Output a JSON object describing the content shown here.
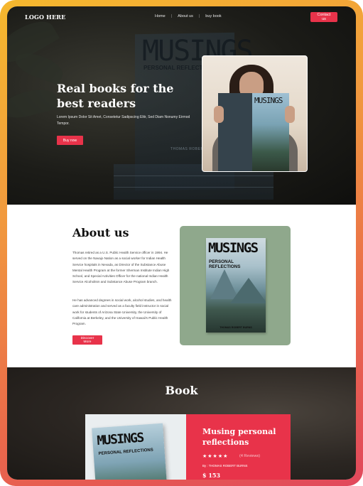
{
  "nav": {
    "logo": "LOGO HERE",
    "links": [
      "Home",
      "About us",
      "buy book"
    ],
    "contact": "Contact us"
  },
  "hero": {
    "title": "Real books for the best readers",
    "text": "Lorem Ipsum Dolor Sit Amet, Consetetur Sadipscing Elitr, Sed Diam Nonumy Eirmod Tempor.",
    "button": "Buy now",
    "bg_book_title": "MUSINGS",
    "bg_book_subtitle": "PERSONAL REFLECTIONS",
    "bg_book_author": "THOMAS ROBERT BURNS"
  },
  "about": {
    "title": "About us",
    "p1": "Thomas retired as a U.S. Public Health Service officer in 1994. He served on the Navajo Nation as a social worker for Indian Health Service hospitals in Nevada, as Director of the Substance Abuse Mental Health Program at the former Sherman Institute Indian High School, and Special Activities Officer for the national Indian Health Service Alcoholism and Substance Abuse Program branch.",
    "p2": "He has advanced degrees in social work, alcohol studies, and health care administration and served as a faculty field instructor in social work for students of Arizona State University, the University of California at Berkeley, and the University of Hawaii's Public Health Program.",
    "button": "Discover More",
    "cover_title": "MUSINGS",
    "cover_subtitle": "PERSONAL REFLECTIONS",
    "cover_author": "THOMAS ROBERT BURNS"
  },
  "book": {
    "title": "Book",
    "cover_title": "MUSINGS",
    "cover_subtitle": "PERSONAL REFLECTIONS",
    "name": "Musing personal reflections",
    "stars": "★★★★★",
    "reviews": "(4 Reviews)",
    "by": "By : THOMAS ROBERT BURNS",
    "price": "$ 153",
    "rating": 5
  },
  "colors": {
    "accent": "#e8334a",
    "card_green": "#8fa88c"
  }
}
